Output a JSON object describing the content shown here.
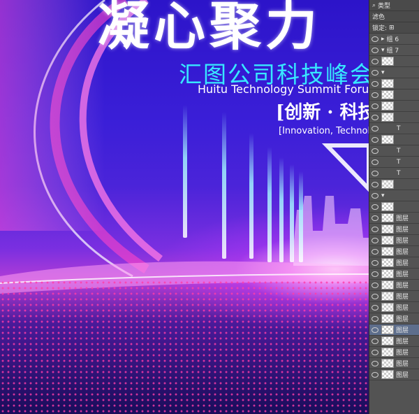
{
  "poster": {
    "title_brush": "凝心聚力",
    "title_cn": "汇图公司科技峰会",
    "title_en": "Huitu Technology Summit Forum",
    "slogan_cn": "[创新 · 科技",
    "slogan_en": "[Innovation, Technology"
  },
  "layers_panel": {
    "filter_kind": "类型",
    "blend_mode": "滤色",
    "lock_label": "锁定:",
    "group_6": "组 6",
    "group_7": "组 7",
    "layer_name": "图层",
    "text_layer_icon": "T",
    "accent_color": "#535353"
  }
}
